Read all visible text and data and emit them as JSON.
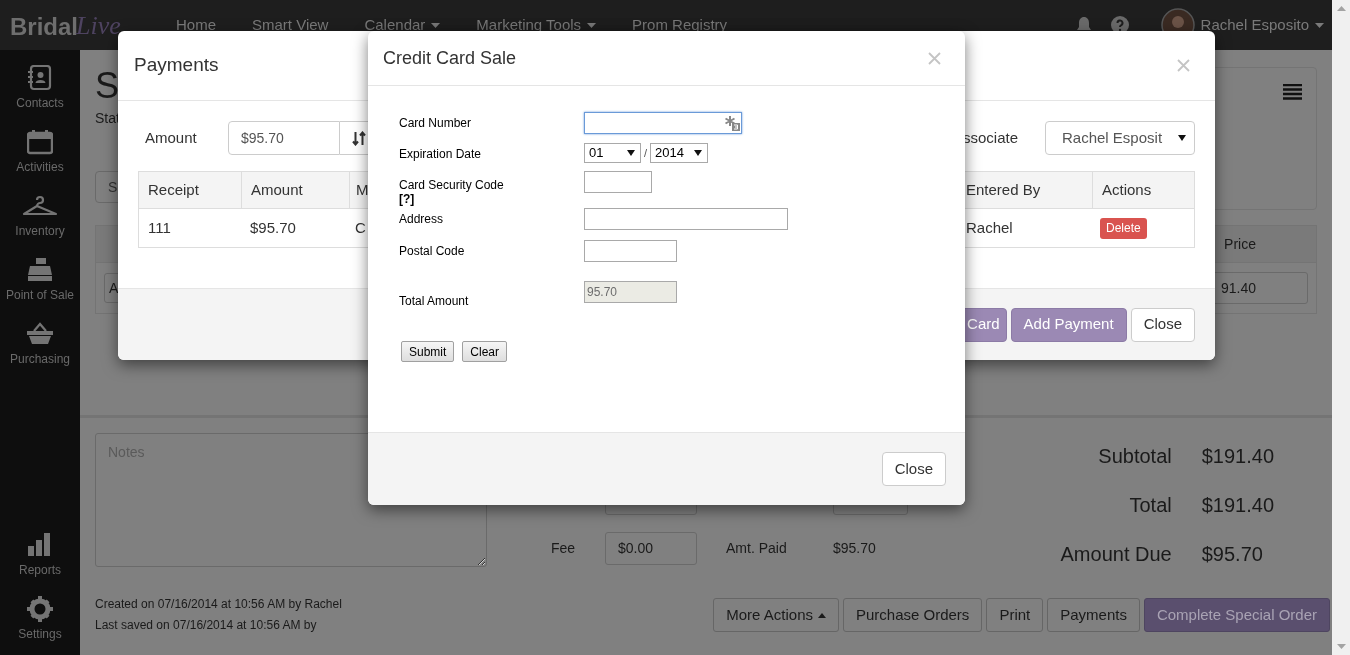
{
  "navbar": {
    "logo": {
      "word": "Bridal",
      "script": "Live"
    },
    "menu": [
      {
        "label": "Home",
        "dropdown": false
      },
      {
        "label": "Smart View",
        "dropdown": false
      },
      {
        "label": "Calendar",
        "dropdown": true
      },
      {
        "label": "Marketing Tools",
        "dropdown": true
      },
      {
        "label": "Prom Registry",
        "dropdown": false
      }
    ],
    "user": {
      "name": "Rachel Esposito"
    }
  },
  "sidebar": {
    "items": [
      {
        "label": "Contacts",
        "kind": "contacts"
      },
      {
        "label": "Activities",
        "kind": "calendar"
      },
      {
        "label": "Inventory",
        "kind": "hanger"
      },
      {
        "label": "Point of Sale",
        "kind": "register"
      },
      {
        "label": "Purchasing",
        "kind": "basket"
      }
    ],
    "bottom_items": [
      {
        "label": "Reports",
        "kind": "bars"
      },
      {
        "label": "Settings",
        "kind": "gear"
      }
    ]
  },
  "page": {
    "title": "S",
    "status_label": "Stat",
    "filter_button": "S",
    "table": {
      "price_column": "Price",
      "row_field": "A",
      "row_price": "91.40"
    },
    "notes": {
      "placeholder": "Notes"
    },
    "fee": {
      "label": "Fee",
      "value": "$0.00"
    },
    "amount_paid": {
      "label": "Amt. Paid",
      "value": "$95.70"
    },
    "totals": [
      {
        "label": "Subtotal",
        "value": "$191.40"
      },
      {
        "label": "Total",
        "value": "$191.40"
      },
      {
        "label": "Amount Due",
        "value": "$95.70"
      }
    ],
    "footer_info": [
      "Created on 07/16/2014 at 10:56 AM by Rachel",
      "Last saved on 07/16/2014 at 10:56 AM by"
    ],
    "actions": [
      {
        "label": "More Actions",
        "kind": "dropup"
      },
      {
        "label": "Purchase Orders",
        "kind": "default"
      },
      {
        "label": "Print",
        "kind": "default"
      },
      {
        "label": "Payments",
        "kind": "default"
      },
      {
        "label": "Complete Special Order",
        "kind": "primary"
      }
    ]
  },
  "payments_dialog": {
    "title": "Payments",
    "amount": {
      "label": "Amount",
      "value": "$95.70"
    },
    "associate": {
      "label": "ssociate",
      "value": "Rachel Esposit"
    },
    "columns": [
      "Receipt",
      "Amount",
      "M",
      "Entered By",
      "Actions"
    ],
    "rows": [
      {
        "cells": [
          "111",
          "$95.70",
          "C",
          "Rachel"
        ],
        "action": "Delete"
      }
    ],
    "buttons": [
      {
        "label": "Card",
        "kind": "primary"
      },
      {
        "label": "Add Payment",
        "kind": "primary"
      },
      {
        "label": "Close",
        "kind": "default"
      }
    ]
  },
  "credit_card_dialog": {
    "title": "Credit Card Sale",
    "fields": [
      {
        "kind": "card_number",
        "label": "Card Number",
        "focused": true
      },
      {
        "kind": "expiry",
        "label": "Expiration Date",
        "month": "01",
        "separator": "/",
        "year": "2014"
      },
      {
        "kind": "security_code",
        "label": "Card Security Code",
        "help": "[?]"
      },
      {
        "kind": "address",
        "label": "Address"
      },
      {
        "kind": "postal_code",
        "label": "Postal Code"
      },
      {
        "kind": "total",
        "label": "Total Amount",
        "value": "95.70"
      }
    ],
    "form_buttons": [
      "Submit",
      "Clear"
    ],
    "footer_button": "Close"
  }
}
